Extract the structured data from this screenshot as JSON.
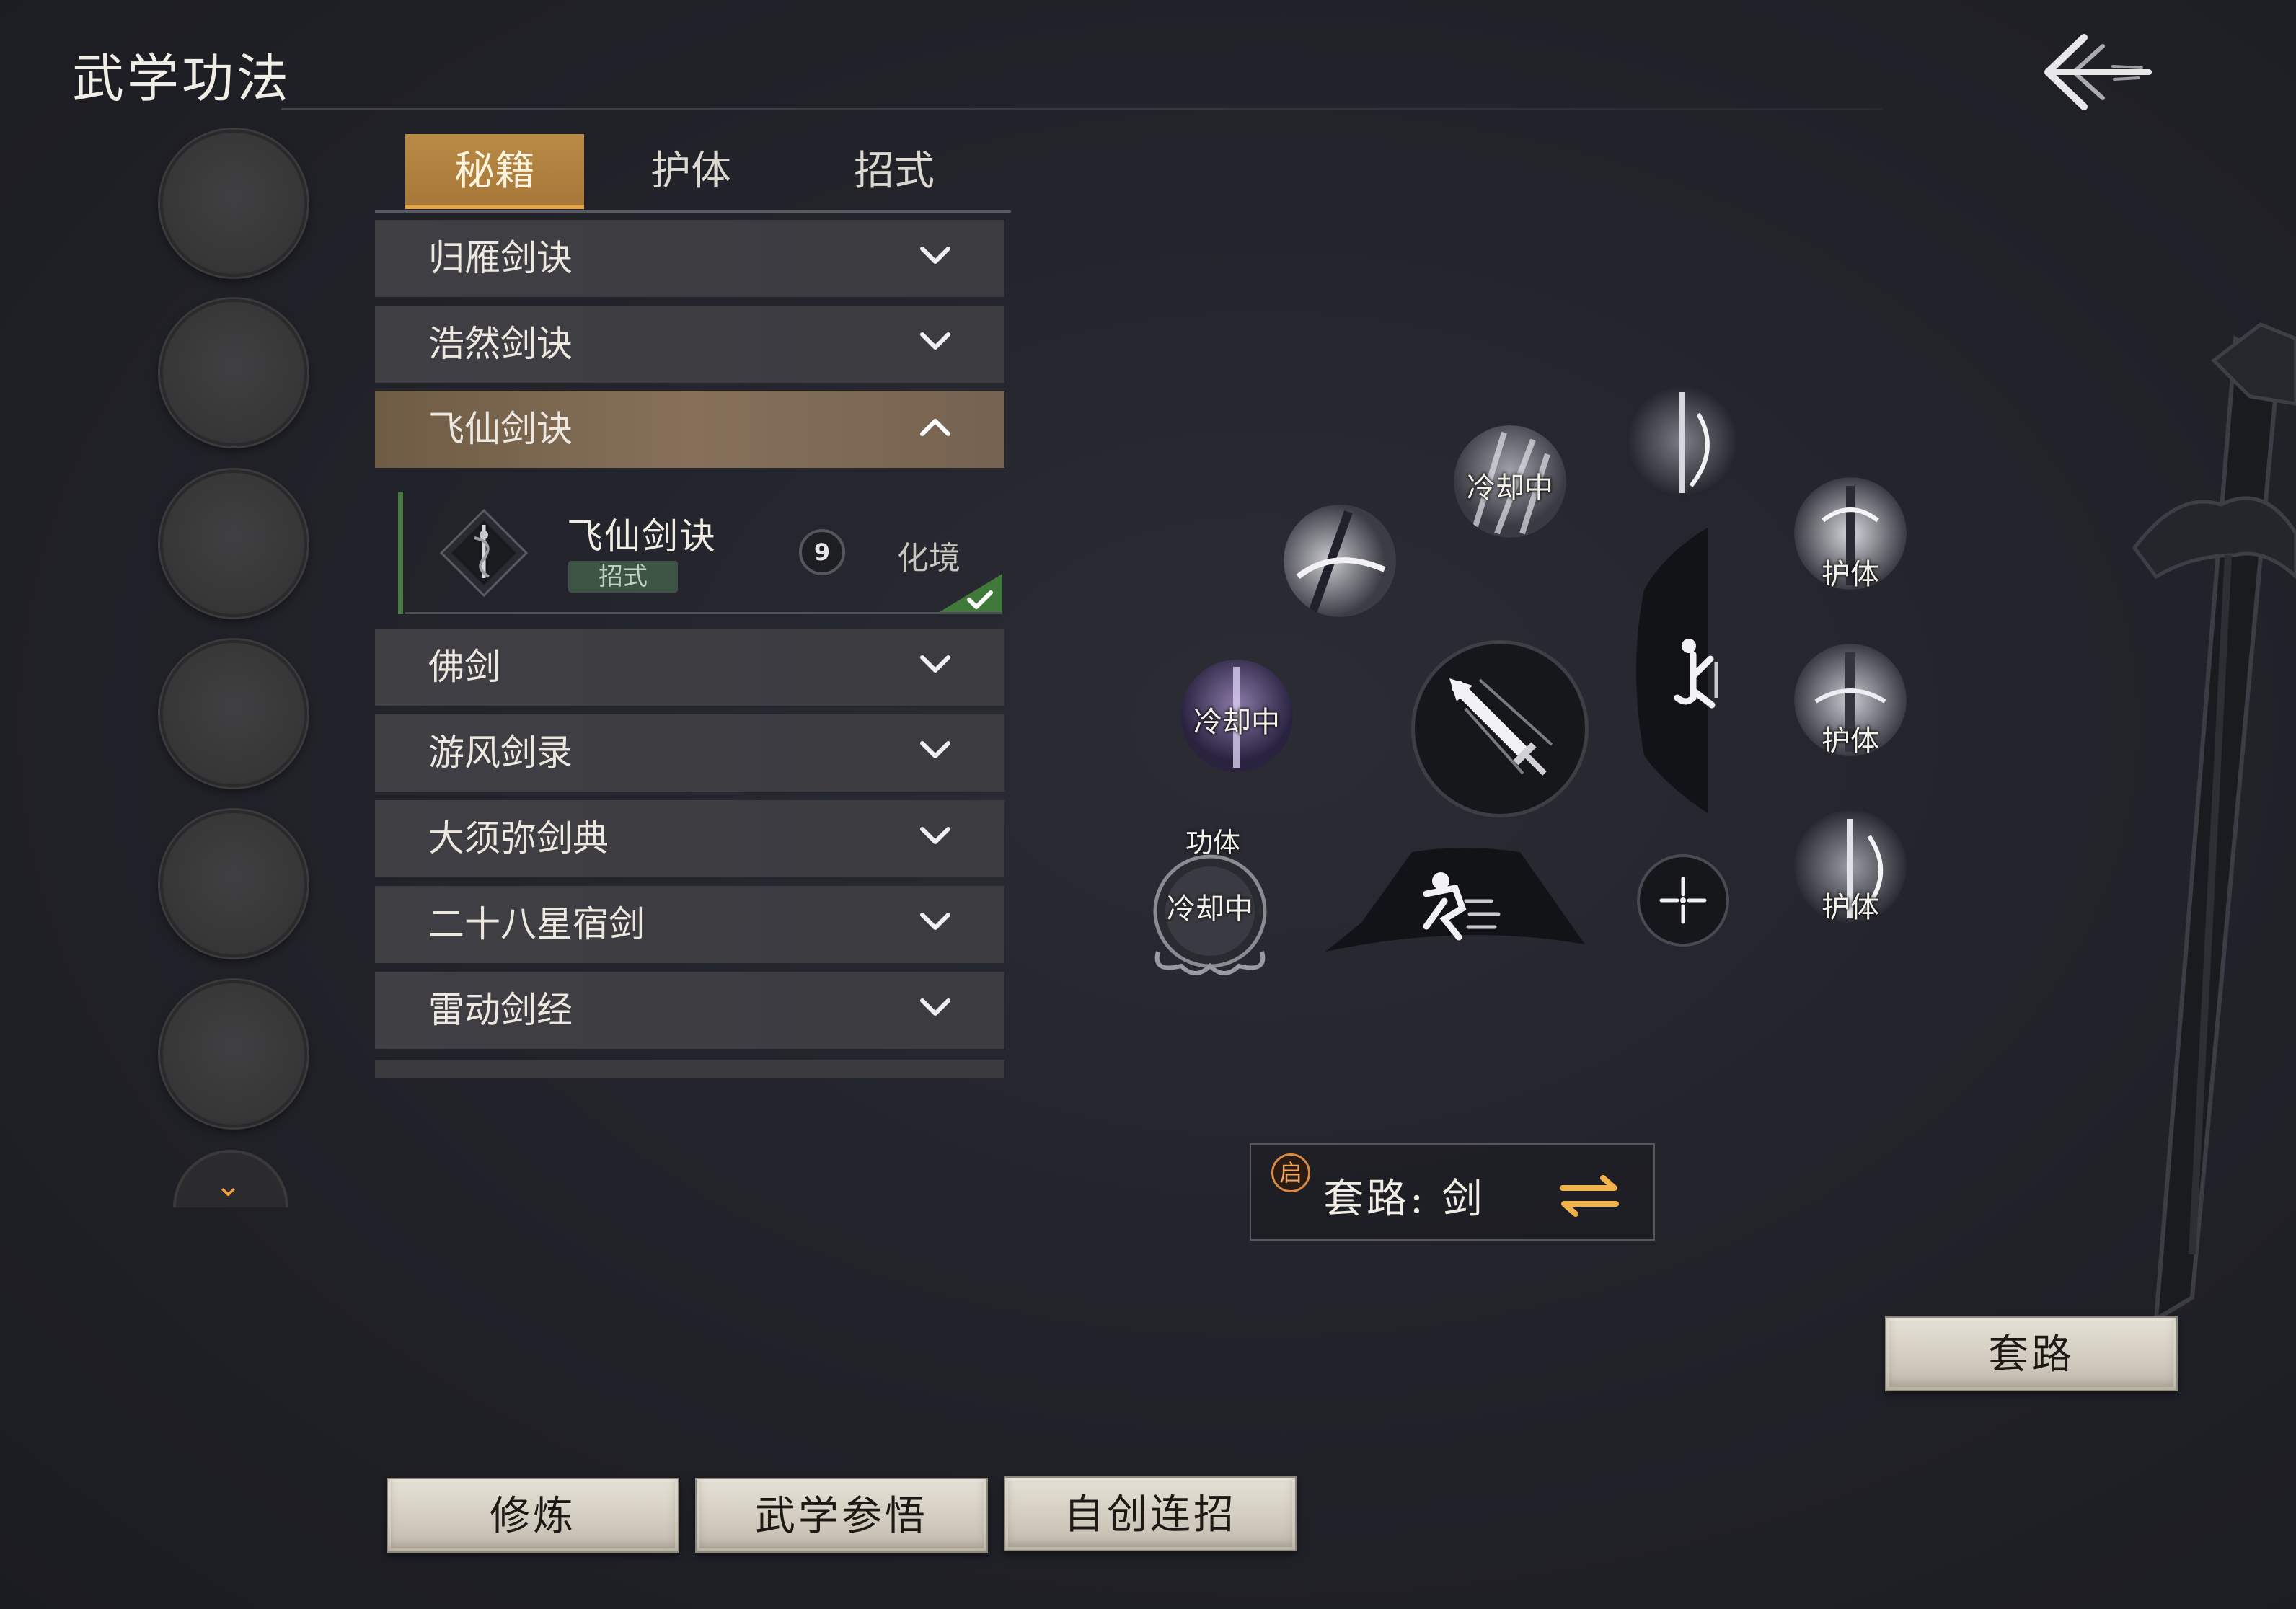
{
  "header": {
    "title": "武学功法"
  },
  "tabs": [
    {
      "label": "秘籍",
      "active": true
    },
    {
      "label": "护体",
      "active": false
    },
    {
      "label": "招式",
      "active": false
    }
  ],
  "books": [
    {
      "label": "归雁剑诀",
      "expanded": false
    },
    {
      "label": "浩然剑诀",
      "expanded": false
    },
    {
      "label": "飞仙剑诀",
      "expanded": true
    },
    {
      "label": "佛剑",
      "expanded": false
    },
    {
      "label": "游风剑录",
      "expanded": false
    },
    {
      "label": "大须弥剑典",
      "expanded": false
    },
    {
      "label": "二十八星宿剑",
      "expanded": false
    },
    {
      "label": "雷动剑经",
      "expanded": false
    }
  ],
  "expanded_item": {
    "name": "飞仙剑诀",
    "tag": "招式",
    "level": "9",
    "realm": "化境",
    "equipped": true
  },
  "wheel": {
    "cooldown": "冷却中",
    "body_skill": "功体",
    "guard": "护体"
  },
  "routine": {
    "badge": "启",
    "label": "套路: 剑"
  },
  "buttons": {
    "routine": "套路",
    "practice": "修炼",
    "comprehend": "武学参悟",
    "custom_combo": "自创连招"
  },
  "colors": {
    "accent_gold": "#b98a45",
    "accent_orange": "#f0a040",
    "equipped_green": "#4b7a45"
  }
}
